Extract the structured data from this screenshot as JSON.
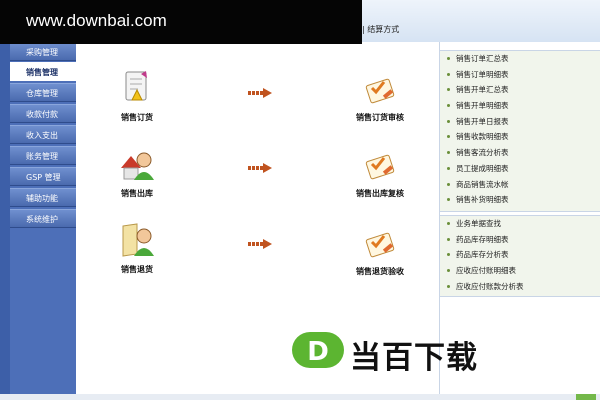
{
  "watermark": {
    "site": "www.downbai.com",
    "logo_text": "当百下载"
  },
  "menubar": {
    "tail_text": "| 结算方式"
  },
  "sidebar": {
    "items": [
      {
        "label": "采购管理"
      },
      {
        "label": "销售管理"
      },
      {
        "label": "仓库管理"
      },
      {
        "label": "收款付款"
      },
      {
        "label": "收入支出"
      },
      {
        "label": "账务管理"
      },
      {
        "label": "GSP 管理"
      },
      {
        "label": "辅助功能"
      },
      {
        "label": "系统维护"
      }
    ],
    "active_index": 1
  },
  "flow": {
    "rows": [
      {
        "left_label": "销售订货",
        "right_label": "销售订货审核"
      },
      {
        "left_label": "销售出库",
        "right_label": "销售出库复核"
      },
      {
        "left_label": "销售退货",
        "right_label": "销售退货验收"
      }
    ]
  },
  "reports": {
    "group1": [
      "销售订单汇总表",
      "销售订单明细表",
      "销售开单汇总表",
      "销售开单明细表",
      "销售开单日报表",
      "销售收款明细表",
      "销售客流分析表",
      "员工提成明细表",
      "商品销售流水帐",
      "销售补货明细表"
    ],
    "group2": [
      "业务单据查找",
      "药品库存明细表",
      "药品库存分析表",
      "应收应付账明细表",
      "应收应付账款分析表"
    ]
  },
  "colors": {
    "sidebar": "#4d6fb8",
    "arrow": "#c0531f",
    "logo_green": "#5cb531",
    "report_bg": "#f1f5ec"
  }
}
